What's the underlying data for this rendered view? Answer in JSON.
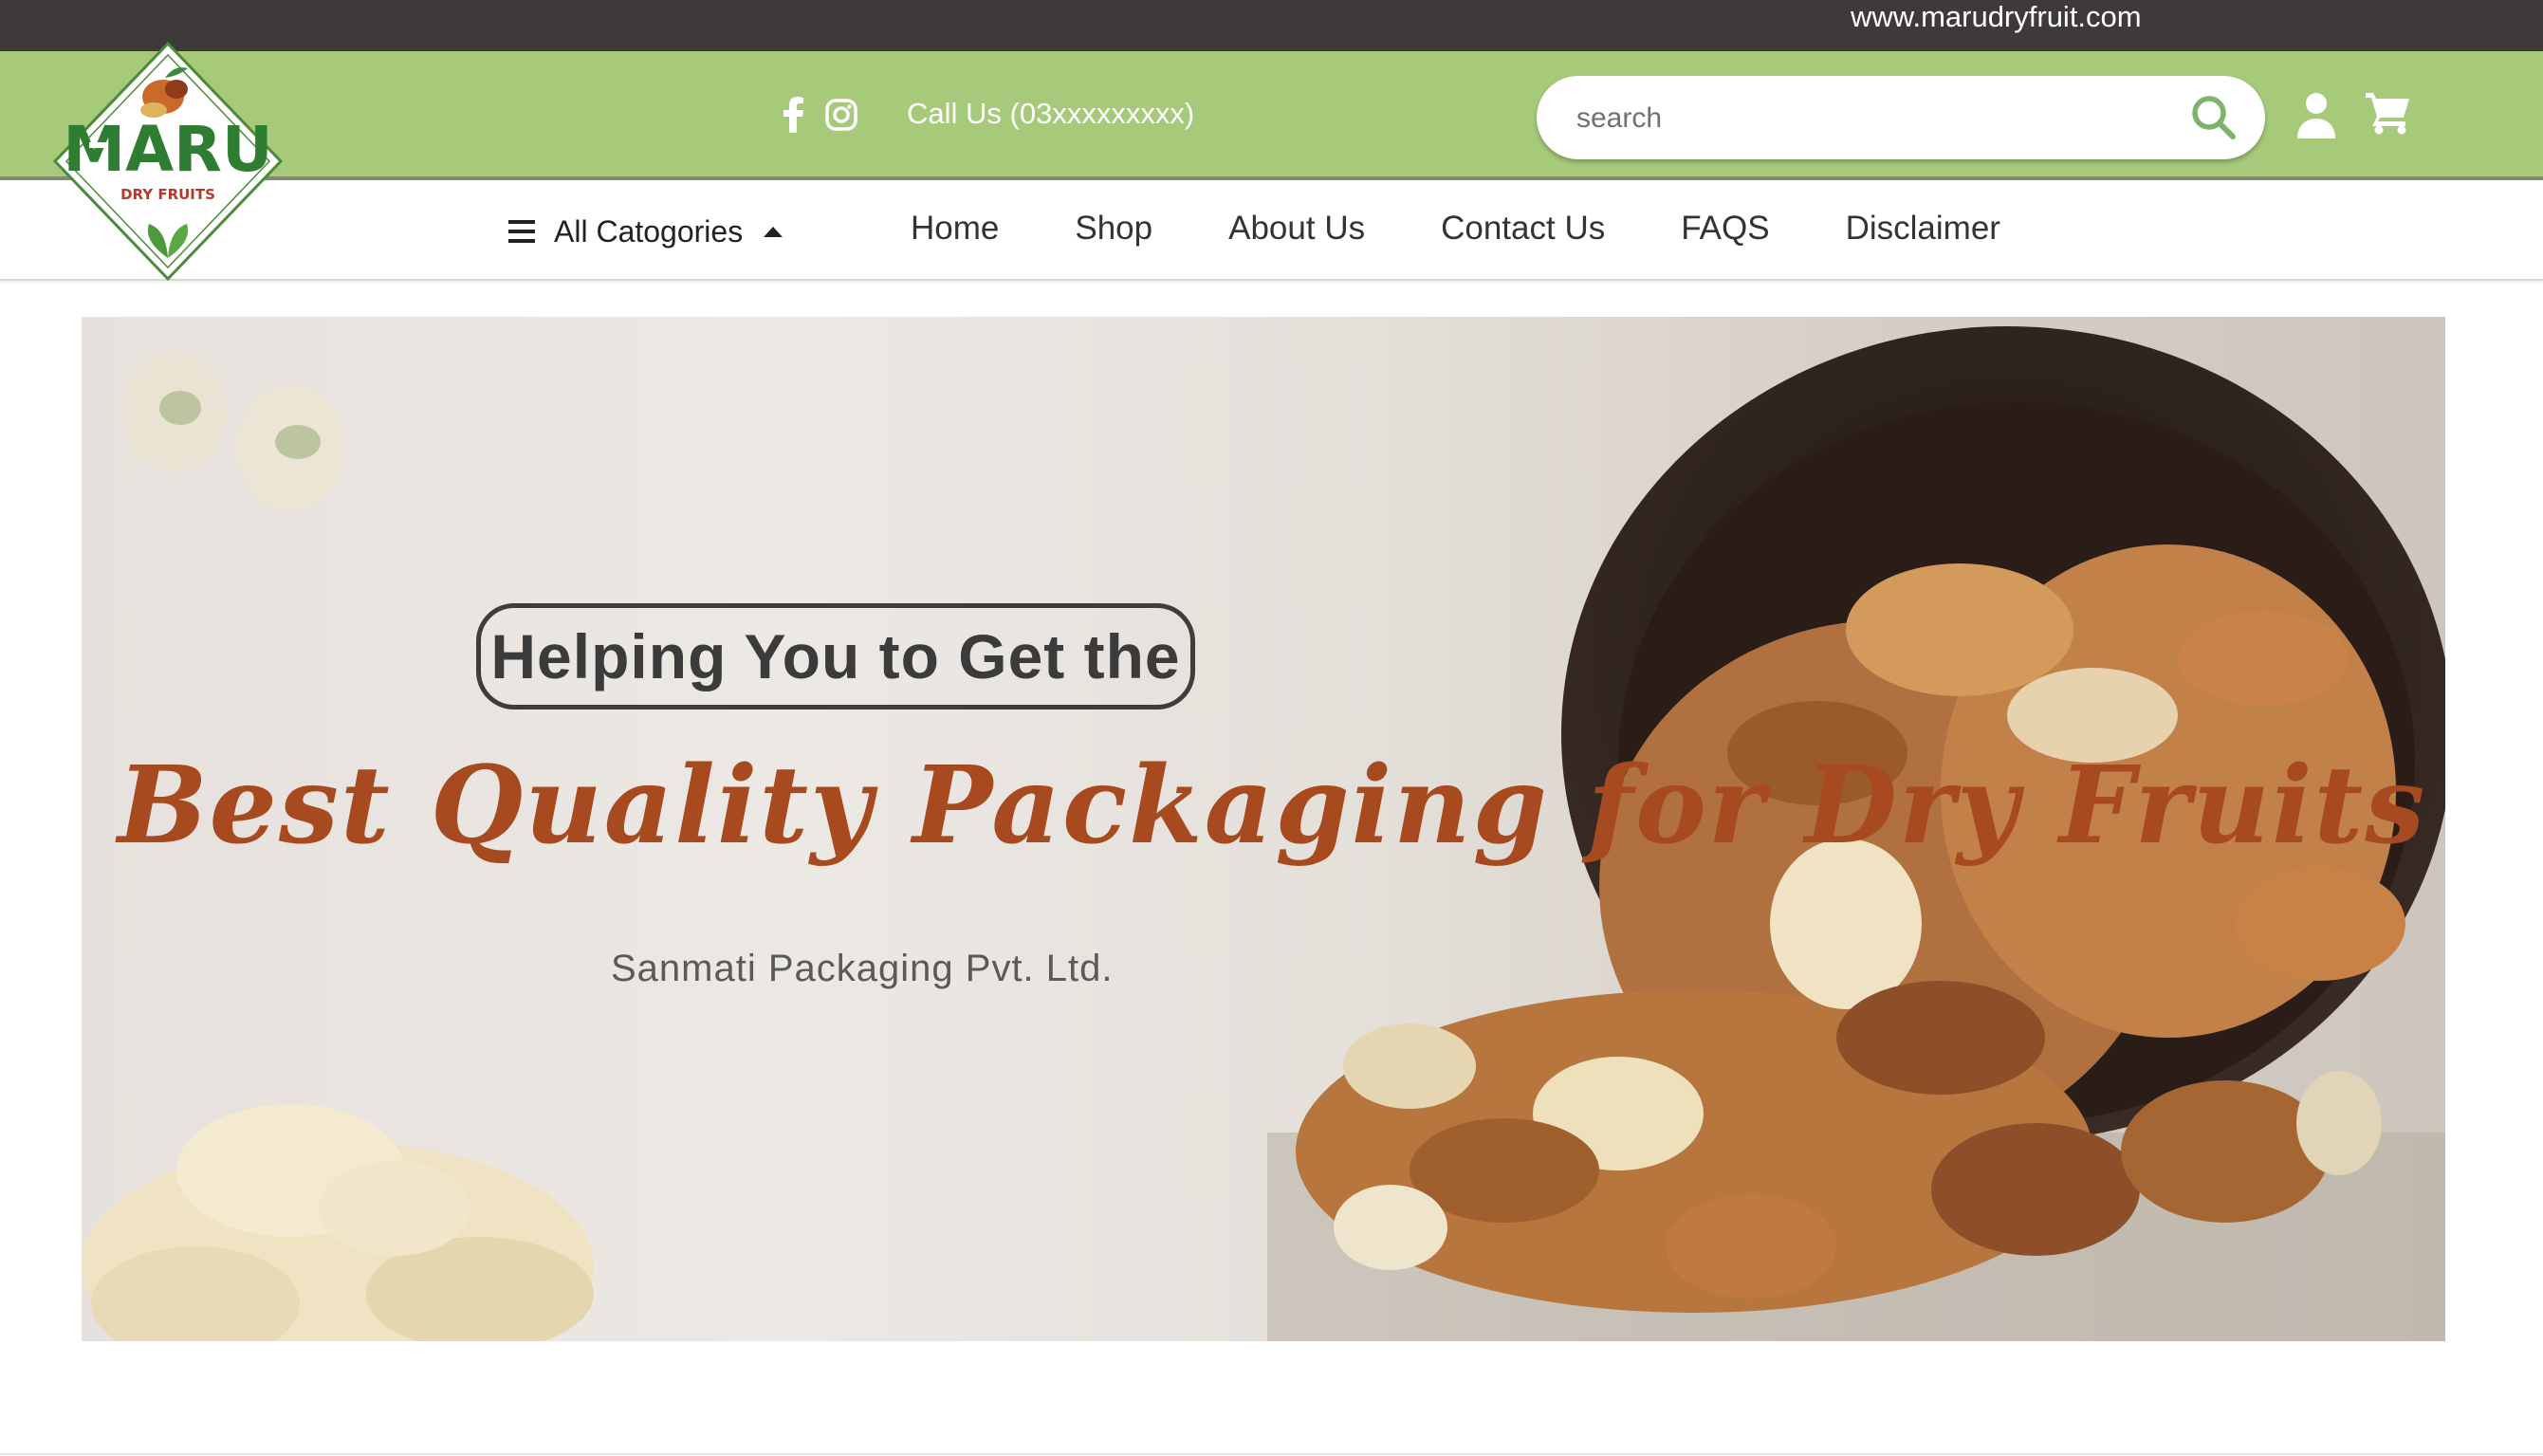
{
  "topbar": {
    "site_url": "www.marudryfruit.com"
  },
  "header": {
    "call_text": "Call Us (03xxxxxxxxx)",
    "search_placeholder": "search",
    "social": [
      "facebook-icon",
      "instagram-icon"
    ]
  },
  "logo": {
    "brand": "MARU",
    "sub": "DRY FRUITS"
  },
  "navbar": {
    "categories_label": "All Catogories",
    "links": [
      "Home",
      "Shop",
      "About Us",
      "Contact Us",
      "FAQS",
      "Disclaimer"
    ]
  },
  "banner": {
    "tagline": "Helping You to Get the",
    "headline": "Best Quality Packaging for Dry Fruits",
    "company": "Sanmati Packaging Pvt. Ltd."
  },
  "colors": {
    "topbar": "#3e3a39",
    "header": "#a6c97a",
    "headline": "#a84a1f",
    "logo_green": "#2e7d32"
  }
}
